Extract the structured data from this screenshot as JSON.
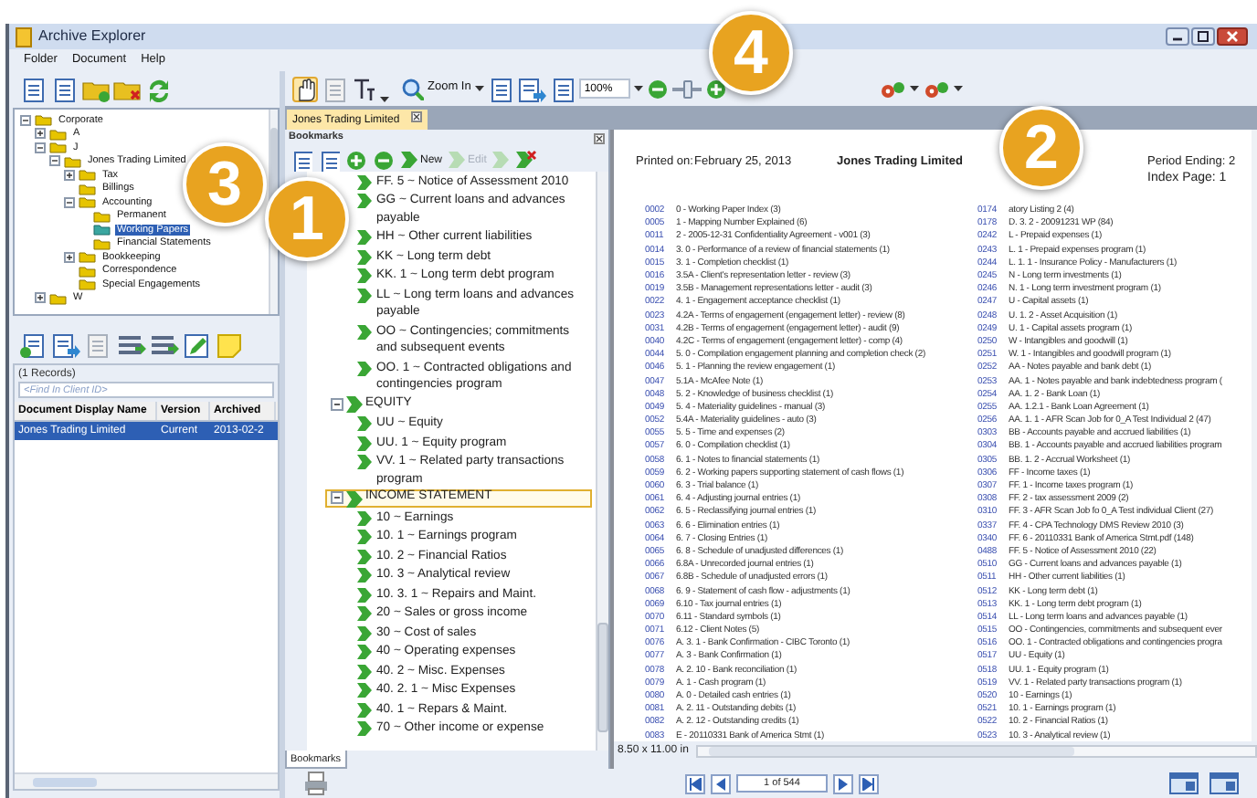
{
  "window": {
    "title": "Archive Explorer"
  },
  "menu": [
    "Folder",
    "Document",
    "Help"
  ],
  "folder_tree": [
    {
      "label": "Corporate",
      "expanded": true,
      "selected": false,
      "children": [
        {
          "label": "A",
          "expanded": false,
          "selected": false
        },
        {
          "label": "J",
          "expanded": true,
          "selected": false,
          "children": [
            {
              "label": "Jones Trading Limited",
              "expanded": true,
              "selected": false,
              "children": [
                {
                  "label": "Tax",
                  "expanded": false,
                  "selected": false
                },
                {
                  "label": "Billings",
                  "selected": false
                },
                {
                  "label": "Accounting",
                  "expanded": true,
                  "selected": false,
                  "children": [
                    {
                      "label": "Permanent",
                      "selected": false
                    },
                    {
                      "label": "Working Papers",
                      "selected": true
                    },
                    {
                      "label": "Financial Statements",
                      "selected": false
                    }
                  ]
                },
                {
                  "label": "Bookkeeping",
                  "expanded": false,
                  "selected": false
                },
                {
                  "label": "Correspondence",
                  "selected": false
                },
                {
                  "label": "Special Engagements",
                  "selected": false
                }
              ]
            }
          ]
        },
        {
          "label": "W",
          "expanded": false,
          "selected": false
        }
      ]
    }
  ],
  "records": {
    "caption": "(1 Records)",
    "filter_placeholder": "<Find In Client ID>",
    "columns": [
      "Document Display Name",
      "Version",
      "Archived"
    ],
    "rows": [
      {
        "cells": [
          "Jones Trading Limited",
          "Current",
          "2013-02-2"
        ],
        "selected": true
      }
    ]
  },
  "toolbar": {
    "zoom_label": "Zoom In",
    "zoom_value": "100%",
    "zoom_slider": {
      "level": 0.5
    }
  },
  "document_tab": {
    "label": "Jones Trading Limited",
    "selected": true
  },
  "bookmarks": {
    "title": "Bookmarks",
    "new_label": "New",
    "edit_label": "Edit",
    "edit_disabled": true,
    "tab_label": "Bookmarks",
    "items": [
      {
        "children": [
          {
            "label": "FF. 5 ~ Notice of Assessment 2010",
            "selected": false
          },
          {
            "label": "GG ~ Current loans and advances payable",
            "selected": false
          },
          {
            "label": "HH ~ Other current liabilities",
            "selected": false
          },
          {
            "label": "KK ~ Long term debt",
            "selected": false
          },
          {
            "label": "KK. 1 ~ Long term debt program",
            "selected": false
          },
          {
            "label": "LL ~ Long term loans and advances payable",
            "selected": false
          },
          {
            "label": "OO ~ Contingencies; commitments and subsequent events",
            "selected": false
          },
          {
            "label": "OO. 1 ~ Contracted obligations and contingencies program",
            "selected": false
          }
        ]
      },
      {
        "label": "EQUITY",
        "expanded": true,
        "selected": false,
        "children": [
          {
            "label": "UU ~ Equity",
            "selected": false
          },
          {
            "label": "UU. 1 ~ Equity program",
            "selected": false
          },
          {
            "label": "VV. 1 ~ Related party transactions program",
            "selected": false
          }
        ]
      },
      {
        "label": "INCOME STATEMENT",
        "expanded": true,
        "selected": true,
        "children": [
          {
            "label": "10 ~ Earnings",
            "selected": false
          },
          {
            "label": "10. 1 ~ Earnings program",
            "selected": false
          },
          {
            "label": "10. 2 ~ Financial Ratios",
            "selected": false
          },
          {
            "label": "10. 3 ~ Analytical review",
            "selected": false
          },
          {
            "label": "10. 3.  1 ~ Repairs and Maint.",
            "selected": false
          },
          {
            "label": "20 ~ Sales or gross income",
            "selected": false
          },
          {
            "label": "30 ~ Cost of sales",
            "selected": false
          },
          {
            "label": "40 ~ Operating expenses",
            "selected": false
          },
          {
            "label": "40. 2 ~ Misc. Expenses",
            "selected": false
          },
          {
            "label": "40. 2.  1 ~ Misc Expenses",
            "selected": false
          },
          {
            "label": "40. 1 ~ Repars & Maint.",
            "selected": false
          },
          {
            "label": "70 ~ Other income or expense",
            "selected": false
          }
        ]
      }
    ]
  },
  "page": {
    "printed_label": "Printed on:",
    "printed_date": "February 25, 2013",
    "client": "Jones Trading Limited",
    "period_label": "Period Ending: 2",
    "index_label": "Index Page: 1",
    "columns": [
      [
        {
          "number": "0002",
          "title": "0 - Working Paper Index (3)"
        },
        {
          "number": "0005",
          "title": "1 - Mapping Number Explained (6)"
        },
        {
          "number": "0011",
          "title": "2 - 2005-12-31 Confidentiality Agreement - v001 (3)"
        },
        {
          "number": "0014",
          "title": "3. 0 - Performance of a review of financial statements (1)"
        },
        {
          "number": "0015",
          "title": "3. 1 - Completion checklist (1)"
        },
        {
          "number": "0016",
          "title": "3.5A - Client's representation letter - review (3)"
        },
        {
          "number": "0019",
          "title": "3.5B - Management representations letter - audit (3)"
        },
        {
          "number": "0022",
          "title": "4. 1 - Engagement acceptance checklist (1)"
        },
        {
          "number": "0023",
          "title": "4.2A - Terms of engagement (engagement letter) - review (8)"
        },
        {
          "number": "0031",
          "title": "4.2B - Terms of engagement (engagement letter) - audit (9)"
        },
        {
          "number": "0040",
          "title": "4.2C - Terms of engagement (engagement letter) - comp (4)"
        },
        {
          "number": "0044",
          "title": "5. 0 - Compilation engagement planning and completion check (2)"
        },
        {
          "number": "0046",
          "title": "5. 1 - Planning the review engagement (1)"
        },
        {
          "number": "0047",
          "title": "5.1A - McAfee Note (1)"
        },
        {
          "number": "0048",
          "title": "5. 2 - Knowledge of business checklist (1)"
        },
        {
          "number": "0049",
          "title": "5. 4 - Materiality guidelines - manual (3)"
        },
        {
          "number": "0052",
          "title": "5.4A - Materiality guidelines - auto (3)"
        },
        {
          "number": "0055",
          "title": "5. 5 - Time and expenses (2)"
        },
        {
          "number": "0057",
          "title": "6. 0 - Compilation checklist (1)"
        },
        {
          "number": "0058",
          "title": "6. 1 - Notes to financial statements (1)"
        },
        {
          "number": "0059",
          "title": "6. 2 - Working papers supporting statement of cash flows (1)"
        },
        {
          "number": "0060",
          "title": "6. 3 - Trial balance (1)"
        },
        {
          "number": "0061",
          "title": "6. 4 - Adjusting journal entries (1)"
        },
        {
          "number": "0062",
          "title": "6. 5 - Reclassifying journal entries (1)"
        },
        {
          "number": "0063",
          "title": "6. 6 - Elimination entries (1)"
        },
        {
          "number": "0064",
          "title": "6. 7 - Closing Entries (1)"
        },
        {
          "number": "0065",
          "title": "6. 8 - Schedule of unadjusted differences (1)"
        },
        {
          "number": "0066",
          "title": "6.8A - Unrecorded journal entries (1)"
        },
        {
          "number": "0067",
          "title": "6.8B - Schedule of unadjusted errors (1)"
        },
        {
          "number": "0068",
          "title": "6. 9 - Statement of cash flow - adjustments (1)"
        },
        {
          "number": "0069",
          "title": "6.10 - Tax journal entries (1)"
        },
        {
          "number": "0070",
          "title": "6.11 - Standard symbols (1)"
        },
        {
          "number": "0071",
          "title": "6.12 - Client Notes (5)"
        },
        {
          "number": "0076",
          "title": "A. 3.  1 - Bank Confirmation - CIBC Toronto (1)"
        },
        {
          "number": "0077",
          "title": "A. 3 - Bank Confirmation (1)"
        },
        {
          "number": "0078",
          "title": "A. 2. 10 - Bank reconciliation (1)"
        },
        {
          "number": "0079",
          "title": "A. 1 - Cash program (1)"
        },
        {
          "number": "0080",
          "title": "A. 0 - Detailed cash entries (1)"
        },
        {
          "number": "0081",
          "title": "A. 2. 11 - Outstanding debits (1)"
        },
        {
          "number": "0082",
          "title": "A. 2. 12 - Outstanding credits (1)"
        },
        {
          "number": "0083",
          "title": "E - 20110331  Bank of America  Stmt (1)"
        }
      ],
      [
        {
          "number": "0174",
          "title": "atory Listing 2 (4)"
        },
        {
          "number": "0178",
          "title": "D. 3. 2 - 20091231  WP (84)"
        },
        {
          "number": "0242",
          "title": "L - Prepaid expenses (1)"
        },
        {
          "number": "0243",
          "title": "L. 1 - Prepaid expenses program (1)"
        },
        {
          "number": "0244",
          "title": "L. 1.  1 - Insurance Policy - Manufacturers (1)"
        },
        {
          "number": "0245",
          "title": "N - Long term investments (1)"
        },
        {
          "number": "0246",
          "title": "N. 1 - Long term investment program (1)"
        },
        {
          "number": "0247",
          "title": "U - Capital assets (1)"
        },
        {
          "number": "0248",
          "title": "U. 1.  2 - Asset Acquisition (1)"
        },
        {
          "number": "0249",
          "title": "U. 1 - Capital assets program (1)"
        },
        {
          "number": "0250",
          "title": "W - Intangibles and goodwill (1)"
        },
        {
          "number": "0251",
          "title": "W. 1 - Intangibles and goodwill program (1)"
        },
        {
          "number": "0252",
          "title": "AA - Notes payable and bank debt (1)"
        },
        {
          "number": "0253",
          "title": "AA. 1 - Notes payable and bank indebtedness program ("
        },
        {
          "number": "0254",
          "title": "AA. 1.  2 - Bank Loan (1)"
        },
        {
          "number": "0255",
          "title": "AA. 1.2.1 - Bank Loan Agreement (1)"
        },
        {
          "number": "0256",
          "title": "AA. 1.  1 - AFR Scan Job for 0_A Test Individual 2 (47)"
        },
        {
          "number": "0303",
          "title": "BB - Accounts payable and accrued liabilities (1)"
        },
        {
          "number": "0304",
          "title": "BB. 1 - Accounts payable and accrued liabilities program"
        },
        {
          "number": "0305",
          "title": "BB. 1.  2 - Accrual Worksheet (1)"
        },
        {
          "number": "0306",
          "title": "FF - Income taxes (1)"
        },
        {
          "number": "0307",
          "title": "FF. 1 - Income taxes program (1)"
        },
        {
          "number": "0308",
          "title": "FF. 2 - tax assessment 2009 (2)"
        },
        {
          "number": "0310",
          "title": "FF. 3 - AFR Scan Job fo 0_A Test individual Client (27)"
        },
        {
          "number": "0337",
          "title": "FF. 4 - CPA Technology DMS Review 2010 (3)"
        },
        {
          "number": "0340",
          "title": "FF. 6 - 20110331  Bank of America  Stmt.pdf (148)"
        },
        {
          "number": "0488",
          "title": "FF. 5 - Notice of Assessment 2010 (22)"
        },
        {
          "number": "0510",
          "title": "GG - Current loans and advances payable (1)"
        },
        {
          "number": "0511",
          "title": "HH - Other current liabilities (1)"
        },
        {
          "number": "0512",
          "title": "KK - Long term debt (1)"
        },
        {
          "number": "0513",
          "title": "KK. 1 - Long term debt program (1)"
        },
        {
          "number": "0514",
          "title": "LL - Long term loans and advances payable (1)"
        },
        {
          "number": "0515",
          "title": "OO - Contingencies, commitments and subsequent ever"
        },
        {
          "number": "0516",
          "title": "OO. 1 - Contracted obligations and contingencies progra"
        },
        {
          "number": "0517",
          "title": "UU - Equity (1)"
        },
        {
          "number": "0518",
          "title": "UU. 1 - Equity program (1)"
        },
        {
          "number": "0519",
          "title": "VV. 1 - Related party transactions program (1)"
        },
        {
          "number": "0520",
          "title": "10 - Earnings (1)"
        },
        {
          "number": "0521",
          "title": "10. 1 - Earnings program (1)"
        },
        {
          "number": "0522",
          "title": "10. 2 - Financial Ratios (1)"
        },
        {
          "number": "0523",
          "title": "10. 3 - Analytical review (1)"
        }
      ]
    ]
  },
  "page_size": "8.50 x 11.00 in",
  "pager": "1 of 544",
  "callouts": [
    "1",
    "2",
    "3",
    "4"
  ]
}
